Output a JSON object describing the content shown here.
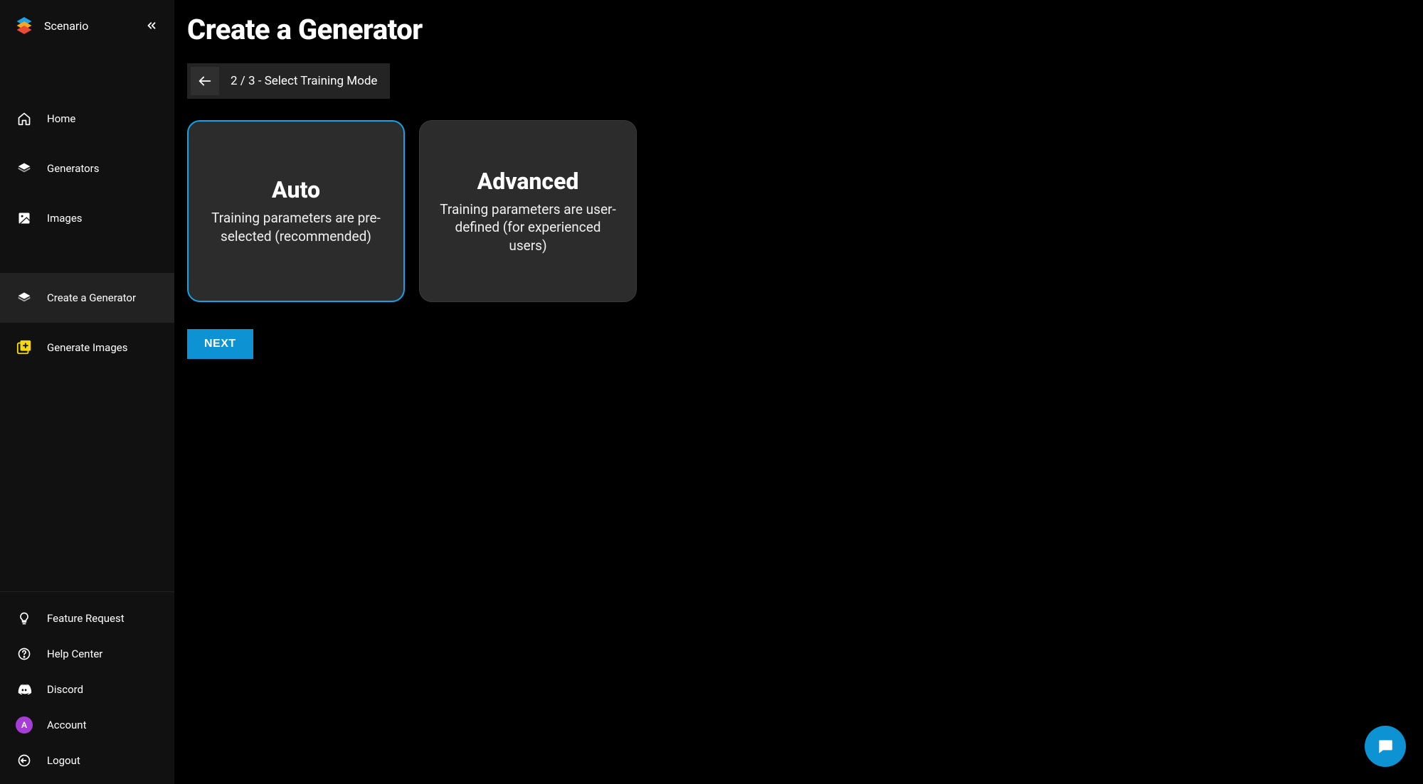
{
  "brand": {
    "name": "Scenario"
  },
  "sidebar": {
    "nav": [
      {
        "label": "Home"
      },
      {
        "label": "Generators"
      },
      {
        "label": "Images"
      },
      {
        "label": "Create a Generator"
      },
      {
        "label": "Generate Images"
      }
    ],
    "bottom": [
      {
        "label": "Feature Request"
      },
      {
        "label": "Help Center"
      },
      {
        "label": "Discord"
      },
      {
        "label": "Account",
        "avatar_initial": "A"
      },
      {
        "label": "Logout"
      }
    ]
  },
  "page": {
    "title": "Create a Generator",
    "step_label": "2 / 3 - Select Training Mode",
    "next_label": "NEXT"
  },
  "cards": {
    "auto": {
      "title": "Auto",
      "desc": "Training parameters are pre-selected (recommended)",
      "selected": true
    },
    "advanced": {
      "title": "Advanced",
      "desc": "Training parameters are user-defined (for experienced users)",
      "selected": false
    }
  },
  "colors": {
    "accent": "#0d92d4",
    "card_bg": "#2c2c2c",
    "sidebar_bg": "#111111"
  }
}
